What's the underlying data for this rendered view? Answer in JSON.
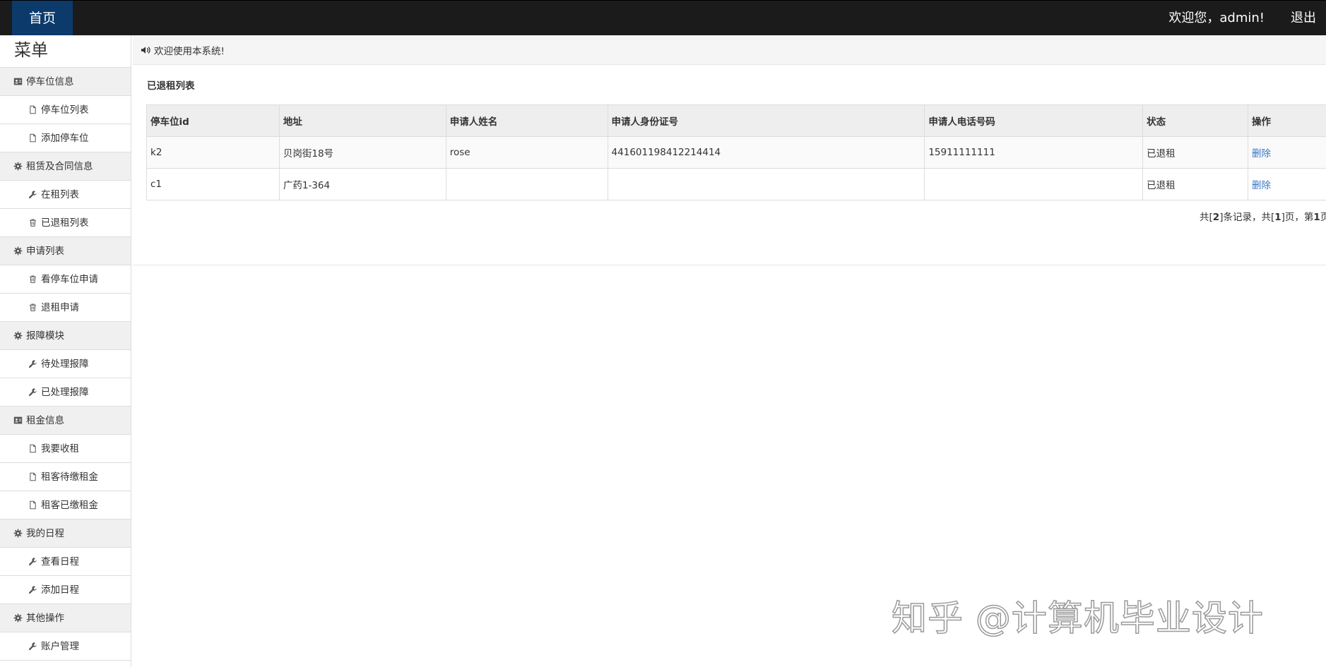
{
  "topbar": {
    "home_label": "首页",
    "welcome_text": "欢迎您，admin!",
    "logout_label": "退出",
    "background": "#1b1b1b",
    "home_tab_color": "#0c3a6b"
  },
  "sidebar": {
    "title": "菜单",
    "groups": [
      {
        "label": "停车位信息",
        "icon": "id-card-icon",
        "items": [
          {
            "label": "停车位列表",
            "icon": "file-icon"
          },
          {
            "label": "添加停车位",
            "icon": "file-icon"
          }
        ]
      },
      {
        "label": "租赁及合同信息",
        "icon": "gear-icon",
        "items": [
          {
            "label": "在租列表",
            "icon": "wrench-icon"
          },
          {
            "label": "已退租列表",
            "icon": "trash-icon"
          }
        ]
      },
      {
        "label": "申请列表",
        "icon": "gear-icon",
        "items": [
          {
            "label": "看停车位申请",
            "icon": "trash-icon"
          },
          {
            "label": "退租申请",
            "icon": "trash-icon"
          }
        ]
      },
      {
        "label": "报障模块",
        "icon": "gear-icon",
        "items": [
          {
            "label": "待处理报障",
            "icon": "wrench-icon"
          },
          {
            "label": "已处理报障",
            "icon": "wrench-icon"
          }
        ]
      },
      {
        "label": "租金信息",
        "icon": "id-card-icon",
        "items": [
          {
            "label": "我要收租",
            "icon": "file-icon"
          },
          {
            "label": "租客待缴租金",
            "icon": "file-icon"
          },
          {
            "label": "租客已缴租金",
            "icon": "file-icon"
          }
        ]
      },
      {
        "label": "我的日程",
        "icon": "gear-icon",
        "items": [
          {
            "label": "查看日程",
            "icon": "wrench-icon"
          },
          {
            "label": "添加日程",
            "icon": "wrench-icon"
          }
        ]
      },
      {
        "label": "其他操作",
        "icon": "gear-icon",
        "items": [
          {
            "label": "账户管理",
            "icon": "wrench-icon"
          }
        ]
      }
    ]
  },
  "notice": {
    "icon": "volume-icon",
    "text": "欢迎使用本系统!"
  },
  "panel": {
    "title": "已退租列表",
    "columns": [
      "停车位id",
      "地址",
      "申请人姓名",
      "申请人身份证号",
      "申请人电话号码",
      "状态",
      "操作"
    ],
    "rows": [
      {
        "id": "k2",
        "address": "贝岗街18号",
        "name": "rose",
        "id_number": "441601198412214414",
        "phone": "15911111111",
        "status": "已退租",
        "action": "删除"
      },
      {
        "id": "c1",
        "address": "广药1-364",
        "name": "",
        "id_number": "",
        "phone": "",
        "status": "已退租",
        "action": "删除"
      }
    ],
    "pagination": {
      "prefix": "共[",
      "total_records": "2",
      "mid1": "]条记录，共[",
      "total_pages": "1",
      "mid2": "]页，第",
      "current_page": "1",
      "suffix": "页"
    },
    "link_color": "#3b77c2"
  },
  "watermark": {
    "text": "知乎 @计算机毕业设计"
  }
}
